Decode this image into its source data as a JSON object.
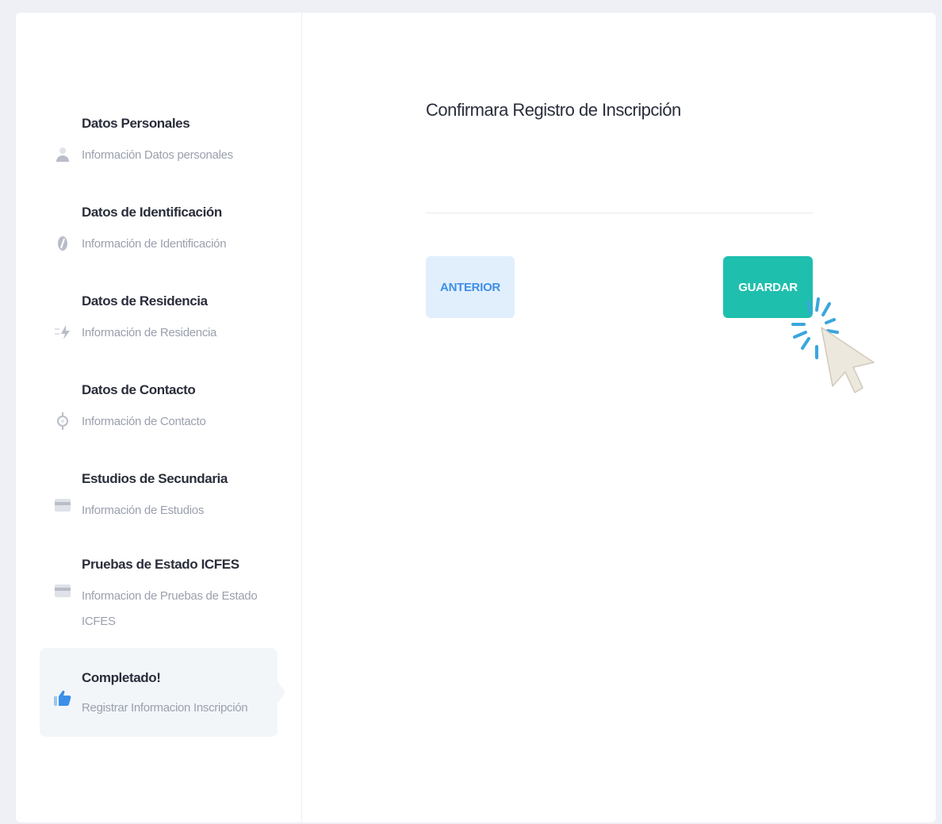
{
  "steps": [
    {
      "title": "Datos Personales",
      "desc": "Información Datos personales",
      "icon": "user-icon"
    },
    {
      "title": "Datos de Identificación",
      "desc": "Información de Identificación",
      "icon": "id-badge-icon"
    },
    {
      "title": "Datos de Residencia",
      "desc": "Información de Residencia",
      "icon": "residence-icon"
    },
    {
      "title": "Datos de Contacto",
      "desc": "Información de Contacto",
      "icon": "contact-pin-icon"
    },
    {
      "title": "Estudios de Secundaria",
      "desc": "Información de Estudios",
      "icon": "card-icon"
    },
    {
      "title": "Pruebas de Estado ICFES",
      "desc": "Informacion de Pruebas de Estado ICFES",
      "icon": "card-icon"
    },
    {
      "title": "Completado!",
      "desc": "Registrar Informacion Inscripción",
      "icon": "thumbs-up-icon"
    }
  ],
  "active_step": 6,
  "form": {
    "title": "Confirmara Registro de Inscripción",
    "prev_label": "ANTERIOR",
    "save_label": "GUARDAR"
  },
  "colors": {
    "primary": "#3f8fe6",
    "success": "#1fbfad",
    "active_bg": "#f3f6f9",
    "text": "#2a2e3b",
    "muted": "#9aa0ad"
  }
}
